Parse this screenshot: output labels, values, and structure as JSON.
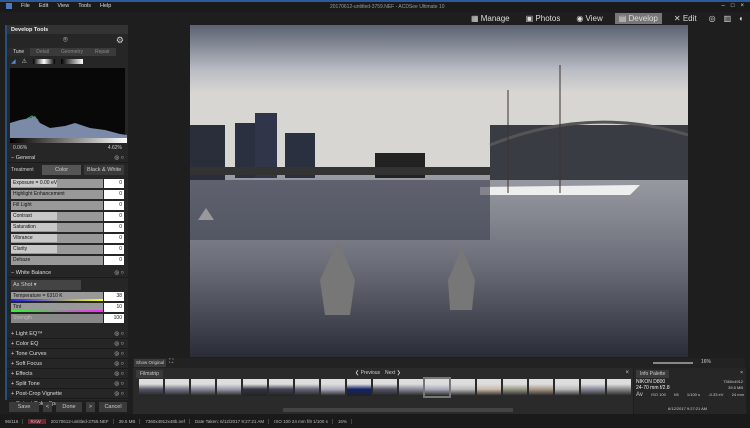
{
  "app": {
    "title": "20170612-untitled-3759.NEF - ACDSee Ultimate 10",
    "menu": [
      "File",
      "Edit",
      "View",
      "Tools",
      "Help"
    ],
    "modes": [
      "Manage",
      "Photos",
      "View",
      "Develop",
      "Edit"
    ],
    "active_mode": "Develop"
  },
  "panel": {
    "title": "Develop Tools",
    "tabs": [
      "Tune",
      "Detail",
      "Geometry",
      "Repair"
    ],
    "histo_left": "0.06%",
    "histo_right": "4.62%",
    "general": {
      "title": "General",
      "treatment_label": "Treatment",
      "color_btn": "Color",
      "bw_btn": "Black & White",
      "sliders": [
        {
          "label": "Exposure = 0.00 eV",
          "value": "0",
          "pos": 0.5
        },
        {
          "label": "Highlight Enhancement",
          "value": "0",
          "pos": 0
        },
        {
          "label": "Fill Light",
          "value": "0",
          "pos": 0
        },
        {
          "label": "Contrast",
          "value": "0",
          "pos": 0.5
        },
        {
          "label": "Saturation",
          "value": "0",
          "pos": 0.5
        },
        {
          "label": "Vibrance",
          "value": "0",
          "pos": 0.5
        },
        {
          "label": "Clarity",
          "value": "0",
          "pos": 0.5
        },
        {
          "label": "Dehaze",
          "value": "0",
          "pos": 0
        }
      ]
    },
    "wb": {
      "title": "White Balance",
      "preset": "As Shot",
      "temp_label": "Temperature = 6310 K",
      "temp_value": "38",
      "tint_label": "Tint",
      "tint_value": "10",
      "strength_label": "Strength",
      "strength_value": "100"
    },
    "sections": [
      "Light EQ™",
      "Color EQ",
      "Tone Curves",
      "Soft Focus",
      "Effects",
      "Split Tone",
      "Post-Crop Vignette",
      "Output Color Space"
    ],
    "save": "Save",
    "done": "Done",
    "cancel": "Cancel"
  },
  "toolbar": {
    "show_original": "Show Original",
    "zoom": "16%"
  },
  "filmstrip": {
    "title": "Filmstrip",
    "previous": "Previous",
    "next": "Next"
  },
  "info": {
    "title": "Info Palette",
    "camera": "NIKON D800",
    "lens": "24-70 mm f/2.8",
    "dims": "7360x4912",
    "size": "39.5 MB",
    "mode": "Av",
    "iso": "ISO 100",
    "aperture": "f/8",
    "shutter": "1/100 s",
    "ev": "-0.33 eV",
    "focal": "24 mm",
    "date": "6/12/2017 9:27:21 AM"
  },
  "status": [
    "96/116",
    "RAW",
    "20170612-untitled-3759.NEF",
    "39.5 MB",
    "7360x4912x48b.nef",
    "Date Taken: 6/12/2017 9:27:21 AM",
    "ISO 100   24 mm   f/8   1/100 s",
    "16%"
  ]
}
